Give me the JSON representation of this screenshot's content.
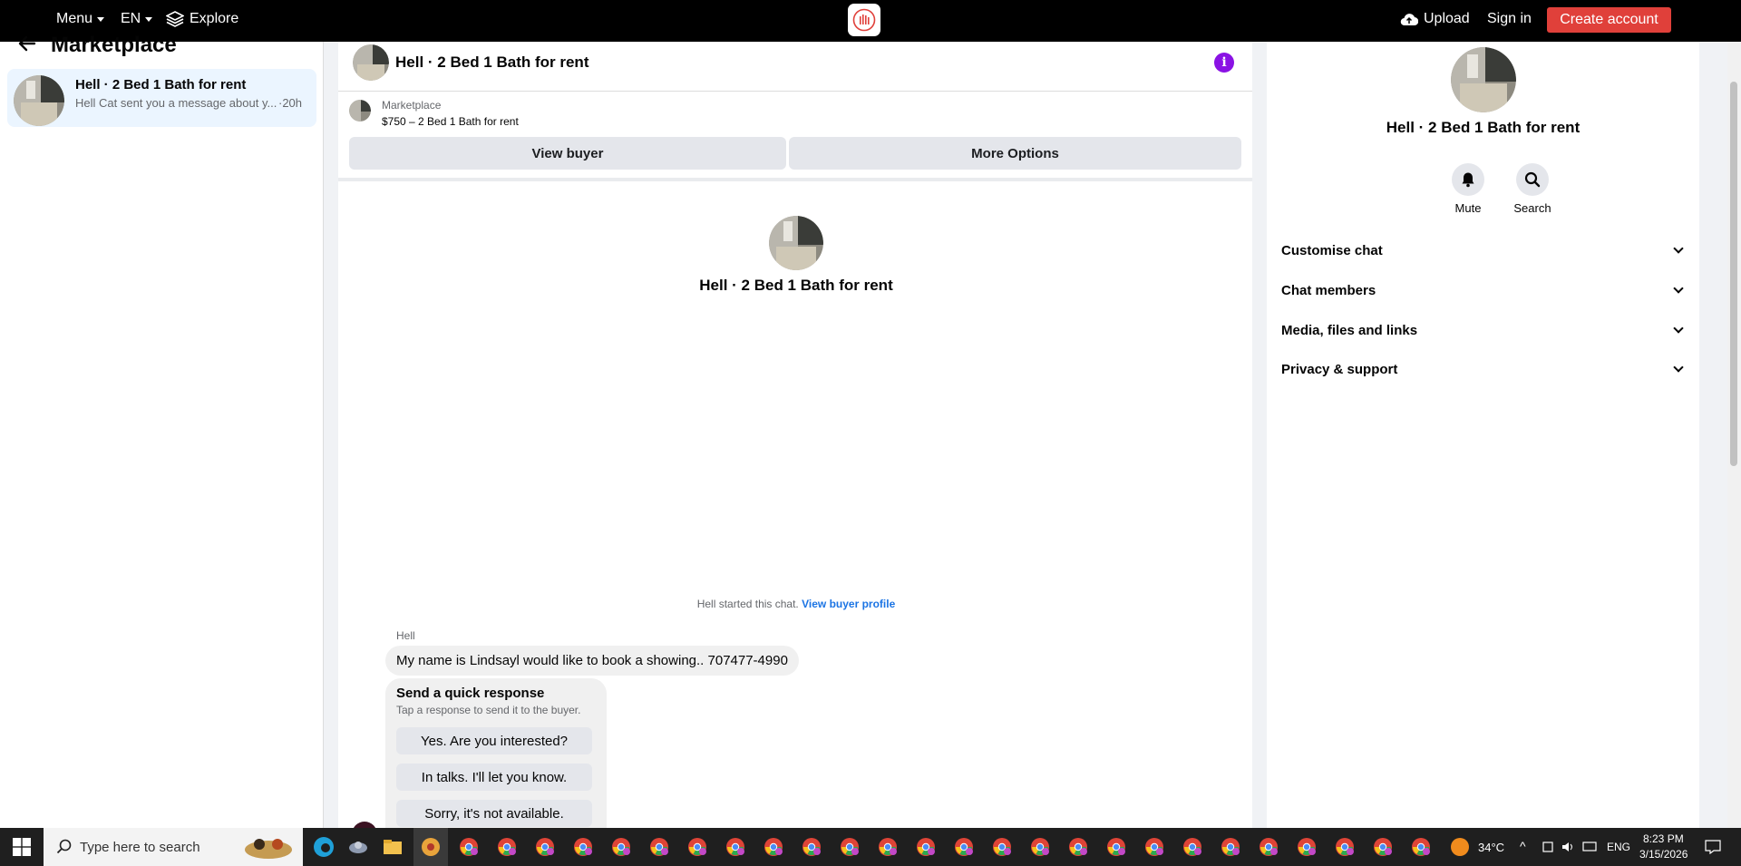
{
  "topbar": {
    "menu_label": "Menu",
    "lang_label": "EN",
    "explore_label": "Explore",
    "upload_label": "Upload",
    "signin_label": "Sign in",
    "create_label": "Create account",
    "create_color": "#e0403a"
  },
  "sidebar": {
    "title": "Marketplace",
    "conversations": [
      {
        "title": "Hell · 2 Bed 1 Bath for rent",
        "preview": "Hell Cat sent you a message about y...",
        "time": "·20h"
      }
    ]
  },
  "chat": {
    "header_title": "Hell · 2 Bed 1 Bath for rent",
    "listing_label": "Marketplace",
    "listing_price": "$750 – 2 Bed 1 Bath for rent",
    "view_buyer_label": "View buyer",
    "more_options_label": "More Options",
    "thread_title": "Hell · 2 Bed 1 Bath for rent",
    "started_text": "Hell started this chat.",
    "buyer_profile_link": "View buyer profile",
    "sender_name": "Hell",
    "message_text": "My name is  Lindsayl would like to book a showing.. 707477-4990",
    "quick_title": "Send a quick response",
    "quick_sub": "Tap a response to send it to the buyer.",
    "quick_responses": [
      "Yes. Are you interested?",
      "In talks. I'll let you know.",
      "Sorry, it's not available."
    ],
    "accent_color": "#8a12e4",
    "link_color": "#1b74e4"
  },
  "details": {
    "title": "Hell · 2 Bed 1 Bath for rent",
    "mute_label": "Mute",
    "search_label": "Search",
    "sections": [
      "Customise chat",
      "Chat members",
      "Media, files and links",
      "Privacy & support"
    ]
  },
  "taskbar": {
    "search_placeholder": "Type here to search",
    "weather": "34°C",
    "lang": "ENG",
    "time": "8:23 PM",
    "date": "3/15/2026"
  }
}
